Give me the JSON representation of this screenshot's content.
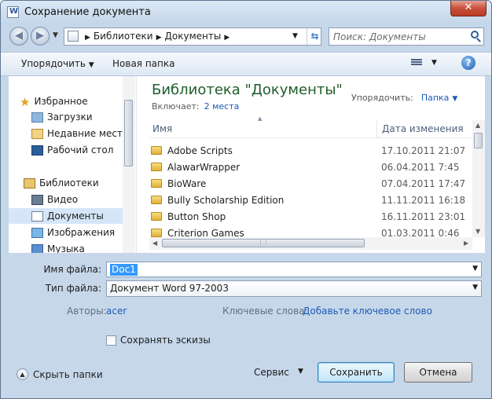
{
  "window": {
    "title": "Сохранение документа",
    "close_label": "✕"
  },
  "address": {
    "crumbs": [
      "Библиотеки",
      "Документы"
    ],
    "search_placeholder": "Поиск: Документы"
  },
  "toolbar": {
    "organize_label": "Упорядочить",
    "new_folder_label": "Новая папка",
    "help_label": "?"
  },
  "sidebar": {
    "favorites_label": "Избранное",
    "favorites": [
      "Загрузки",
      "Недавние места",
      "Рабочий стол"
    ],
    "libraries_label": "Библиотеки",
    "libraries": [
      "Видео",
      "Документы",
      "Изображения",
      "Музыка"
    ],
    "selected": "Документы"
  },
  "library": {
    "title": "Библиотека \"Документы\"",
    "includes_label": "Включает:",
    "includes_value": "2 места",
    "arrange_label": "Упорядочить:",
    "arrange_value": "Папка"
  },
  "columns": {
    "name": "Имя",
    "date": "Дата изменения"
  },
  "files": [
    {
      "name": "Adobe Scripts",
      "date": "17.10.2011 21:07"
    },
    {
      "name": "AlawarWrapper",
      "date": "06.04.2011 7:45"
    },
    {
      "name": "BioWare",
      "date": "07.04.2011 17:47"
    },
    {
      "name": "Bully Scholarship Edition",
      "date": "11.11.2011 16:18"
    },
    {
      "name": "Button Shop",
      "date": "16.11.2011 23:01"
    },
    {
      "name": "Criterion Games",
      "date": "01.03.2011 0:46"
    }
  ],
  "form": {
    "filename_label": "Имя файла:",
    "filename_value": "Doc1",
    "filetype_label": "Тип файла:",
    "filetype_value": "Документ Word 97-2003",
    "authors_label": "Авторы:",
    "authors_value": "acer",
    "keywords_label": "Ключевые слова:",
    "keywords_value": "Добавьте ключевое слово",
    "thumbnails_label": "Сохранять эскизы",
    "thumbnails_checked": false
  },
  "footer": {
    "hide_folders_label": "Скрыть папки",
    "service_label": "Сервис",
    "save_label": "Сохранить",
    "cancel_label": "Отмена"
  },
  "colors": {
    "frame": "#c6d7ea",
    "link": "#1c5ab4",
    "title_green": "#1e5d2c",
    "selection": "#3399ff"
  },
  "icons": [
    "star-icon",
    "downloads-icon",
    "recent-places-icon",
    "desktop-icon",
    "libraries-icon",
    "video-icon",
    "documents-icon",
    "pictures-icon",
    "music-icon",
    "folder-icon",
    "search-icon",
    "help-icon"
  ]
}
